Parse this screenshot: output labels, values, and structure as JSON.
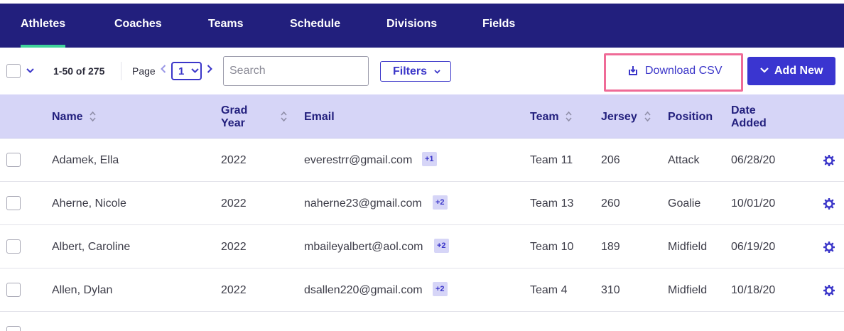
{
  "nav": {
    "tabs": [
      {
        "label": "Athletes",
        "active": true
      },
      {
        "label": "Coaches"
      },
      {
        "label": "Teams"
      },
      {
        "label": "Schedule"
      },
      {
        "label": "Divisions"
      },
      {
        "label": "Fields"
      }
    ]
  },
  "toolbar": {
    "count": "1-50 of 275",
    "page_label": "Page",
    "page_value": "1",
    "search_placeholder": "Search",
    "filters_label": "Filters",
    "download_label": "Download CSV",
    "add_label": "Add New"
  },
  "table": {
    "headers": {
      "name": "Name",
      "grad_year_1": "Grad",
      "grad_year_2": "Year",
      "email": "Email",
      "team": "Team",
      "jersey": "Jersey",
      "position": "Position",
      "date_1": "Date",
      "date_2": "Added"
    },
    "rows": [
      {
        "name": "Adamek, Ella",
        "year": "2022",
        "email": "everestrr@gmail.com",
        "extra": "+1",
        "team": "Team 11",
        "jersey": "206",
        "position": "Attack",
        "date": "06/28/20"
      },
      {
        "name": "Aherne, Nicole",
        "year": "2022",
        "email": "naherne23@gmail.com",
        "extra": "+2",
        "team": "Team 13",
        "jersey": "260",
        "position": "Goalie",
        "date": "10/01/20"
      },
      {
        "name": "Albert, Caroline",
        "year": "2022",
        "email": "mbaileyalbert@aol.com",
        "extra": "+2",
        "team": "Team 10",
        "jersey": "189",
        "position": "Midfield",
        "date": "06/19/20"
      },
      {
        "name": "Allen, Dylan",
        "year": "2022",
        "email": "dsallen220@gmail.com",
        "extra": "+2",
        "team": "Team 4",
        "jersey": "310",
        "position": "Midfield",
        "date": "10/18/20"
      }
    ]
  },
  "colors": {
    "nav_bg": "#221f7d",
    "active_tab_indicator": "#3fd39a",
    "accent": "#3b36c9",
    "header_bg": "#d6d5f7",
    "highlight_border": "#ef6b97"
  }
}
